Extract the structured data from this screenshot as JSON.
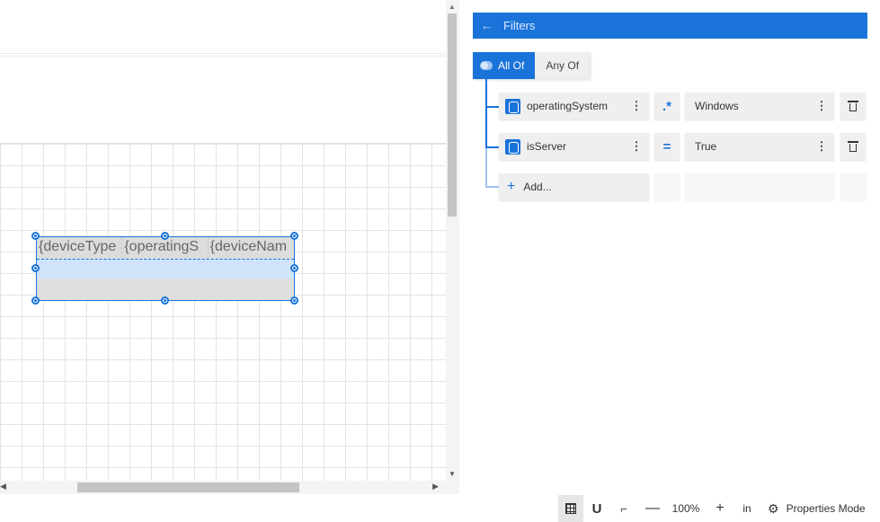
{
  "designer": {
    "table": {
      "columns": [
        "{deviceType",
        "{operatingS",
        "{deviceNam"
      ]
    }
  },
  "filters": {
    "title": "Filters",
    "back_icon": "arrow-left-icon",
    "groups": {
      "all_of": "All Of",
      "any_of": "Any Of",
      "active": "all_of"
    },
    "conditions": [
      {
        "field": "operatingSystem",
        "operator_symbol": ".*",
        "operator_name": "regex-match",
        "value": "Windows"
      },
      {
        "field": "isServer",
        "operator_symbol": "=",
        "operator_name": "equals",
        "value": "True"
      }
    ],
    "add_label": "Add..."
  },
  "toolbar": {
    "zoom": "100%",
    "unit": "in",
    "properties_mode": "Properties Mode",
    "minus": "—",
    "plus": "+"
  },
  "colors": {
    "accent": "#1a73d9",
    "selection_fill": "#cfe4fb"
  }
}
